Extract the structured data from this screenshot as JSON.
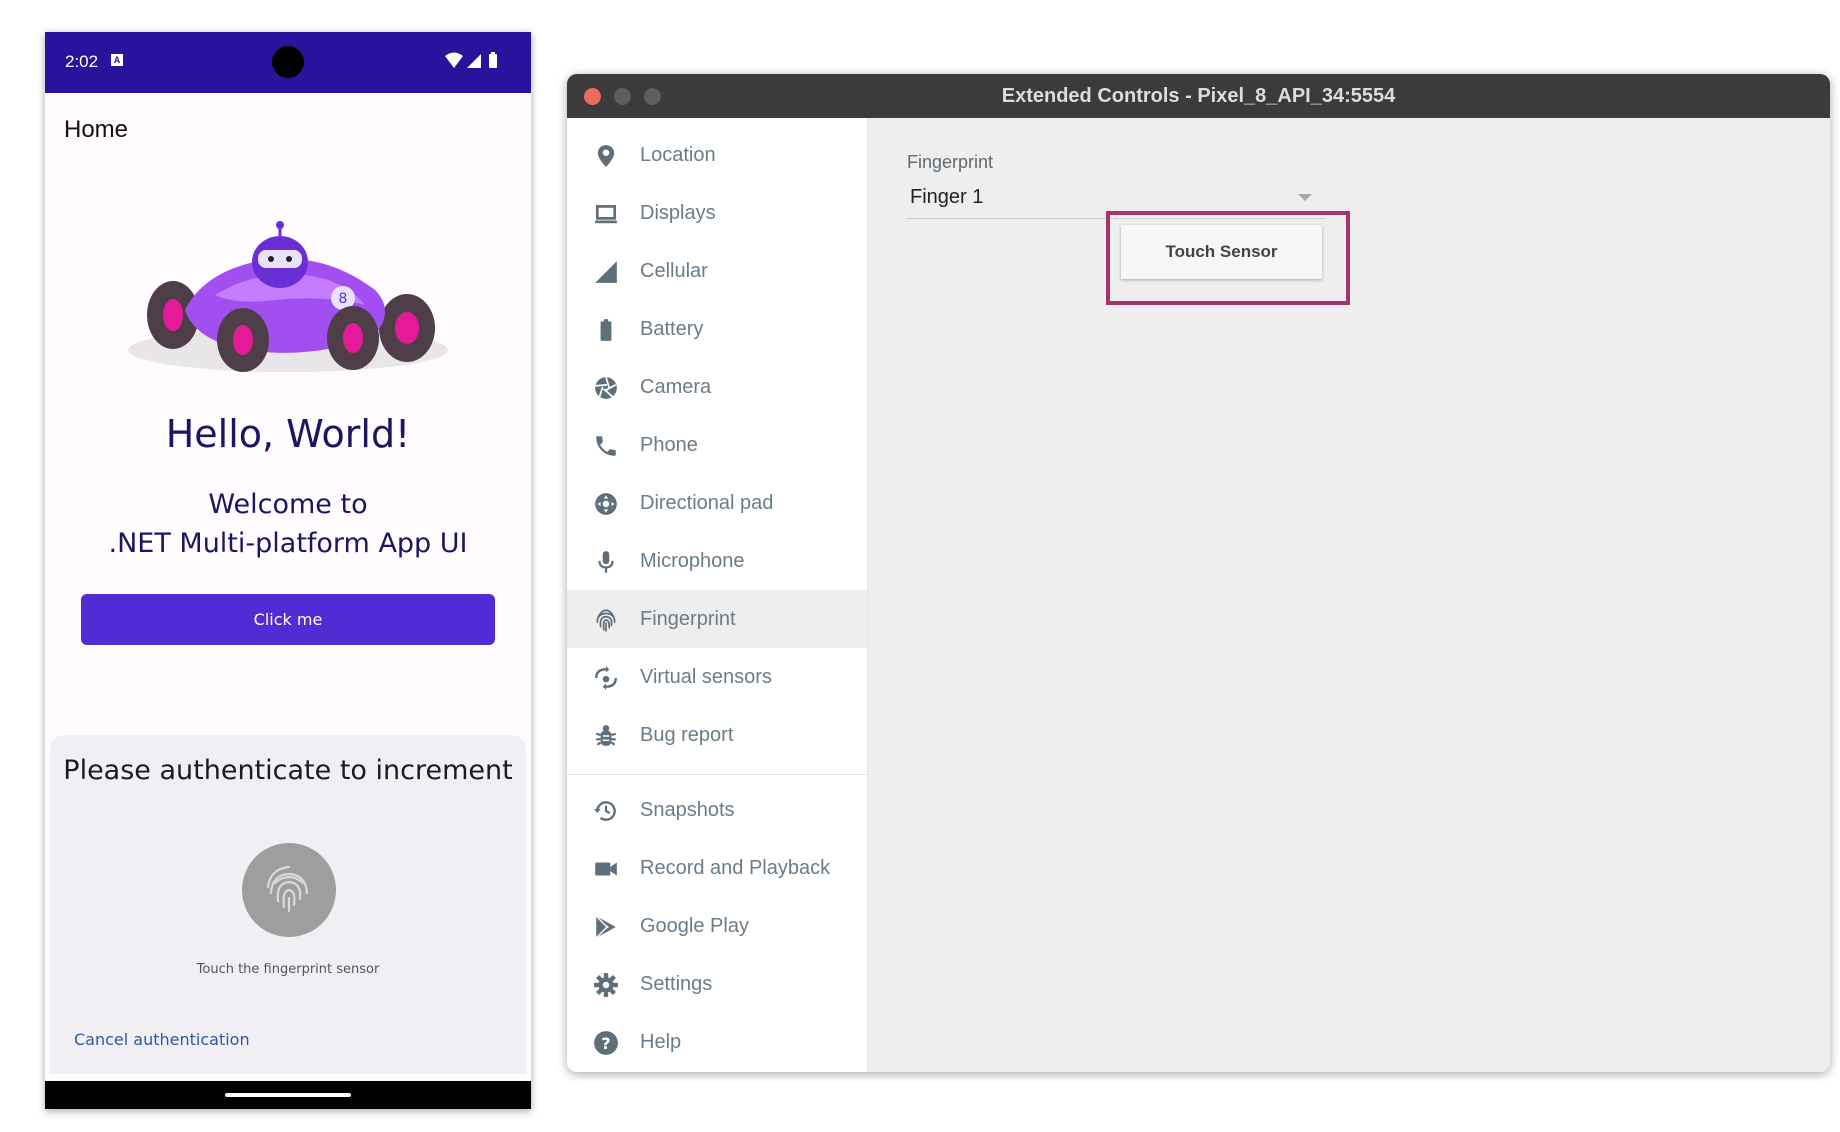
{
  "phone": {
    "status_time": "2:02",
    "status_badge": "A",
    "page_title": "Home",
    "hello": "Hello, World!",
    "welcome_line1": "Welcome to",
    "welcome_line2": ".NET Multi-platform App UI",
    "click_button": "Click me",
    "auth_title": "Please authenticate to increment",
    "auth_hint": "Touch the fingerprint sensor",
    "cancel_auth": "Cancel authentication"
  },
  "window": {
    "title": "Extended Controls - Pixel_8_API_34:5554",
    "sidebar": {
      "items": [
        {
          "label": "Location",
          "icon": "location-pin-icon"
        },
        {
          "label": "Displays",
          "icon": "display-icon"
        },
        {
          "label": "Cellular",
          "icon": "cellular-signal-icon"
        },
        {
          "label": "Battery",
          "icon": "battery-icon"
        },
        {
          "label": "Camera",
          "icon": "camera-aperture-icon"
        },
        {
          "label": "Phone",
          "icon": "phone-icon"
        },
        {
          "label": "Directional pad",
          "icon": "dpad-icon"
        },
        {
          "label": "Microphone",
          "icon": "microphone-icon"
        },
        {
          "label": "Fingerprint",
          "icon": "fingerprint-icon"
        },
        {
          "label": "Virtual sensors",
          "icon": "rotation-icon"
        },
        {
          "label": "Bug report",
          "icon": "bug-icon"
        },
        {
          "label": "Snapshots",
          "icon": "history-icon"
        },
        {
          "label": "Record and Playback",
          "icon": "video-camera-icon"
        },
        {
          "label": "Google Play",
          "icon": "google-play-icon"
        },
        {
          "label": "Settings",
          "icon": "gear-icon"
        },
        {
          "label": "Help",
          "icon": "help-icon"
        }
      ],
      "active": "Fingerprint"
    },
    "fingerprint": {
      "label": "Fingerprint",
      "selected": "Finger 1",
      "touch_button": "Touch Sensor"
    }
  },
  "colors": {
    "status_bar": "#28149c",
    "primary_button": "#512bd4",
    "highlight_border": "#a8316f",
    "titlebar": "#3b3b3b",
    "sidebar_text": "#6b7c87"
  }
}
